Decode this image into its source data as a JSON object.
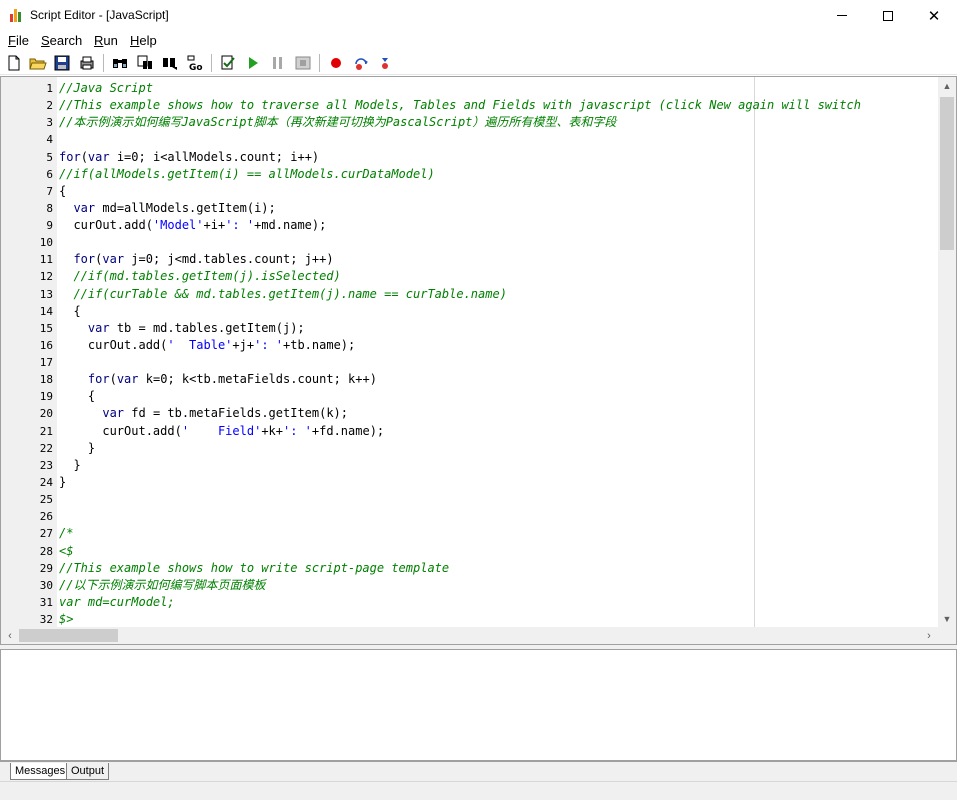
{
  "window": {
    "title": "Script Editor - [JavaScript]",
    "minimize_glyph": "",
    "maximize_glyph": "",
    "close_glyph": "✕"
  },
  "menu": {
    "file": {
      "hotkey": "F",
      "rest": "ile"
    },
    "search": {
      "hotkey": "S",
      "rest": "earch"
    },
    "run": {
      "hotkey": "R",
      "rest": "un"
    },
    "help": {
      "hotkey": "H",
      "rest": "elp"
    }
  },
  "toolbar": {
    "icons": [
      "new-file-icon",
      "open-folder-icon",
      "save-icon",
      "print-icon",
      "find-icon",
      "replace-icon",
      "find-next-icon",
      "goto-line-icon",
      "check-syntax-icon",
      "run-icon",
      "pause-icon",
      "stop-icon",
      "breakpoint-icon",
      "step-into-icon",
      "step-over-icon"
    ]
  },
  "editor": {
    "lines": [
      {
        "n": "1",
        "parts": [
          [
            "cm",
            "//Java Script"
          ]
        ]
      },
      {
        "n": "2",
        "parts": [
          [
            "cm",
            "//This example shows how to traverse all Models, Tables and Fields with javascript (click New again will switch"
          ]
        ]
      },
      {
        "n": "3",
        "parts": [
          [
            "cm",
            "//本示例演示如何编写JavaScript脚本（再次新建可切换为PascalScript）遍历所有模型、表和字段"
          ]
        ]
      },
      {
        "n": "4",
        "parts": []
      },
      {
        "n": "5",
        "parts": [
          [
            "kw",
            "for"
          ],
          [
            "",
            "("
          ],
          [
            "kw",
            "var"
          ],
          [
            "",
            " i="
          ],
          [
            "num",
            "0"
          ],
          [
            "",
            "; i<allModels.count; i++)"
          ]
        ]
      },
      {
        "n": "6",
        "parts": [
          [
            "cm",
            "//if(allModels.getItem(i) == allModels.curDataModel)"
          ]
        ]
      },
      {
        "n": "7",
        "parts": [
          [
            "",
            "{"
          ]
        ]
      },
      {
        "n": "8",
        "parts": [
          [
            "",
            "  "
          ],
          [
            "kw",
            "var"
          ],
          [
            "",
            " md=allModels.getItem(i);"
          ]
        ]
      },
      {
        "n": "9",
        "parts": [
          [
            "",
            "  curOut.add("
          ],
          [
            "st",
            "'Model'"
          ],
          [
            "",
            "+i+"
          ],
          [
            "st",
            "': '"
          ],
          [
            "",
            "+md.name);"
          ]
        ]
      },
      {
        "n": "10",
        "parts": []
      },
      {
        "n": "11",
        "parts": [
          [
            "",
            "  "
          ],
          [
            "kw",
            "for"
          ],
          [
            "",
            "("
          ],
          [
            "kw",
            "var"
          ],
          [
            "",
            " j="
          ],
          [
            "num",
            "0"
          ],
          [
            "",
            "; j<md.tables.count; j++)"
          ]
        ]
      },
      {
        "n": "12",
        "parts": [
          [
            "cm",
            "  //if(md.tables.getItem(j).isSelected)"
          ]
        ]
      },
      {
        "n": "13",
        "parts": [
          [
            "cm",
            "  //if(curTable && md.tables.getItem(j).name == curTable.name)"
          ]
        ]
      },
      {
        "n": "14",
        "parts": [
          [
            "",
            "  {"
          ]
        ]
      },
      {
        "n": "15",
        "parts": [
          [
            "",
            "    "
          ],
          [
            "kw",
            "var"
          ],
          [
            "",
            " tb = md.tables.getItem(j);"
          ]
        ]
      },
      {
        "n": "16",
        "parts": [
          [
            "",
            "    curOut.add("
          ],
          [
            "st",
            "'  Table'"
          ],
          [
            "",
            "+j+"
          ],
          [
            "st",
            "': '"
          ],
          [
            "",
            "+tb.name);"
          ]
        ]
      },
      {
        "n": "17",
        "parts": []
      },
      {
        "n": "18",
        "parts": [
          [
            "",
            "    "
          ],
          [
            "kw",
            "for"
          ],
          [
            "",
            "("
          ],
          [
            "kw",
            "var"
          ],
          [
            "",
            " k="
          ],
          [
            "num",
            "0"
          ],
          [
            "",
            "; k<tb.metaFields.count; k++)"
          ]
        ]
      },
      {
        "n": "19",
        "parts": [
          [
            "",
            "    {"
          ]
        ]
      },
      {
        "n": "20",
        "parts": [
          [
            "",
            "      "
          ],
          [
            "kw",
            "var"
          ],
          [
            "",
            " fd = tb.metaFields.getItem(k);"
          ]
        ]
      },
      {
        "n": "21",
        "parts": [
          [
            "",
            "      curOut.add("
          ],
          [
            "st",
            "'    Field'"
          ],
          [
            "",
            "+k+"
          ],
          [
            "st",
            "': '"
          ],
          [
            "",
            "+fd.name);"
          ]
        ]
      },
      {
        "n": "22",
        "parts": [
          [
            "",
            "    }"
          ]
        ]
      },
      {
        "n": "23",
        "parts": [
          [
            "",
            "  }"
          ]
        ]
      },
      {
        "n": "24",
        "parts": [
          [
            "",
            "}"
          ]
        ]
      },
      {
        "n": "25",
        "parts": []
      },
      {
        "n": "26",
        "parts": []
      },
      {
        "n": "27",
        "parts": [
          [
            "cm",
            "/*"
          ]
        ]
      },
      {
        "n": "28",
        "parts": [
          [
            "cm",
            "<$"
          ]
        ]
      },
      {
        "n": "29",
        "parts": [
          [
            "cm",
            "//This example shows how to write script-page template"
          ]
        ]
      },
      {
        "n": "30",
        "parts": [
          [
            "cm",
            "//以下示例演示如何编写脚本页面模板"
          ]
        ]
      },
      {
        "n": "31",
        "parts": [
          [
            "cm",
            "var md=curModel;"
          ]
        ]
      },
      {
        "n": "32",
        "parts": [
          [
            "cm",
            "$>"
          ]
        ]
      }
    ]
  },
  "bottom": {
    "tabs": [
      "Messages",
      "Output"
    ],
    "active_tab": "Messages"
  },
  "colors": {
    "comment": "#008000",
    "keyword": "#000080",
    "string": "#0000ff",
    "run_icon": "#22a022",
    "breakpoint": "#e00000"
  }
}
